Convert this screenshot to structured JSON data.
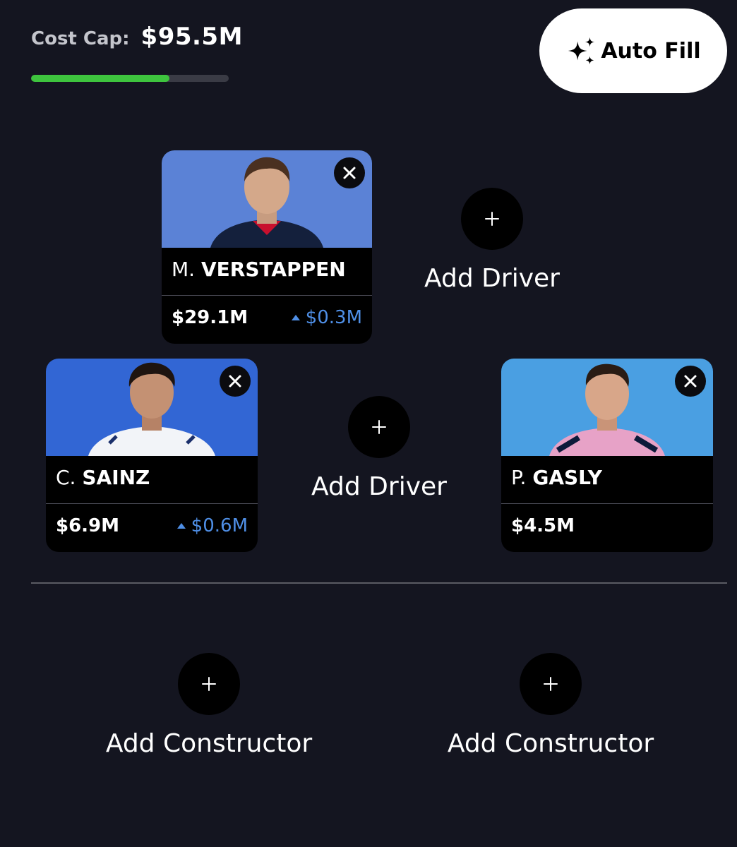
{
  "cost_cap": {
    "label": "Cost Cap:",
    "value": "$95.5M",
    "progress_fraction": 0.7,
    "progress_color": "#3ec43e"
  },
  "autofill": {
    "label": "Auto Fill",
    "icon": "sparkles-icon"
  },
  "drivers": [
    {
      "initial": "M.",
      "surname": "VERSTAPPEN",
      "price": "$29.1M",
      "change": "$0.3M",
      "photo_bg": "#5b82d6"
    },
    {
      "initial": "C.",
      "surname": "SAINZ",
      "price": "$6.9M",
      "change": "$0.6M",
      "photo_bg": "#3266d4"
    },
    {
      "initial": "P.",
      "surname": "GASLY",
      "price": "$4.5M",
      "change": "",
      "photo_bg": "#4a9fe2"
    }
  ],
  "add_driver_label": "Add Driver",
  "add_constructor_label": "Add Constructor",
  "colors": {
    "background": "#141520",
    "change_up": "#4f8fe6"
  }
}
